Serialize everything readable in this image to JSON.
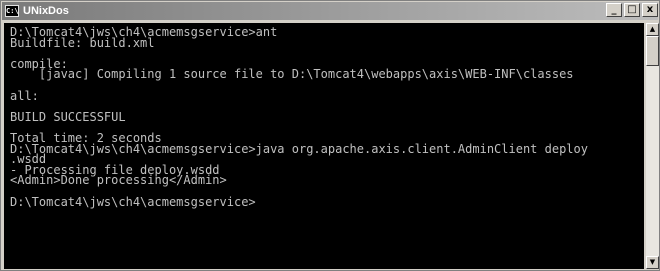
{
  "window": {
    "title": "UNixDos",
    "icon_text": "C:\\",
    "buttons": {
      "minimize": "_",
      "maximize": "□",
      "close": "x"
    }
  },
  "console": {
    "lines": [
      "D:\\Tomcat4\\jws\\ch4\\acmemsgservice>ant",
      "Buildfile: build.xml",
      "",
      "compile:",
      "    [javac] Compiling 1 source file to D:\\Tomcat4\\webapps\\axis\\WEB-INF\\classes",
      "",
      "all:",
      "",
      "BUILD SUCCESSFUL",
      "",
      "Total time: 2 seconds",
      "D:\\Tomcat4\\jws\\ch4\\acmemsgservice>java org.apache.axis.client.AdminClient deploy",
      ".wsdd",
      "- Processing file deploy.wsdd",
      "<Admin>Done processing</Admin>",
      "",
      "D:\\Tomcat4\\jws\\ch4\\acmemsgservice>"
    ]
  },
  "scrollbar": {
    "up_arrow": "▲",
    "down_arrow": "▼"
  }
}
